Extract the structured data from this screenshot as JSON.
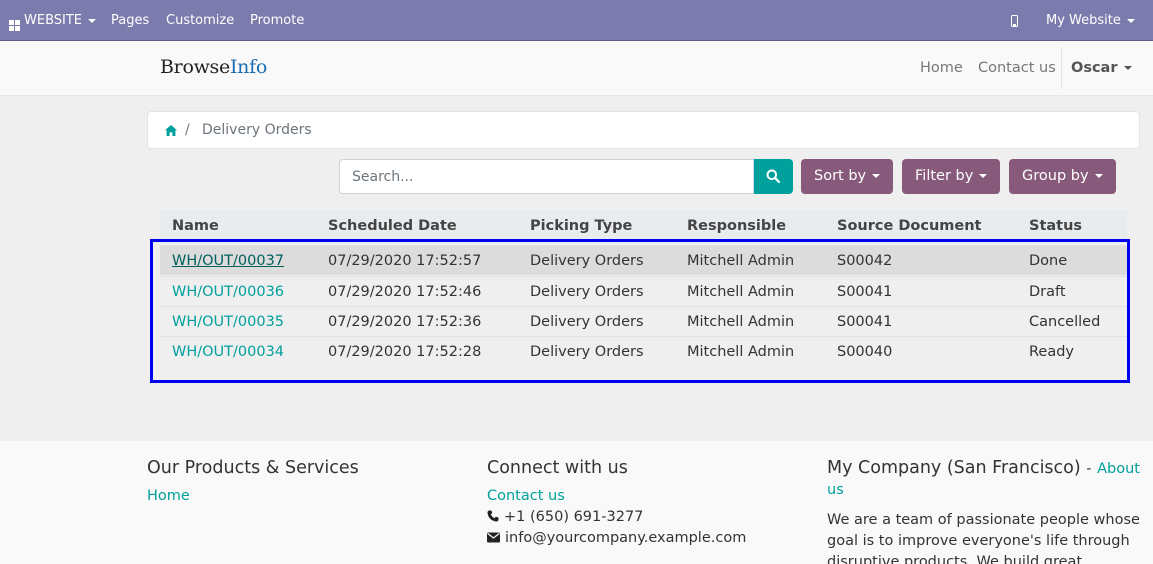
{
  "topbar": {
    "website_label": "WEBSITE",
    "pages_label": "Pages",
    "customize_label": "Customize",
    "promote_label": "Promote",
    "mobile_icon": "mobile-phone-icon",
    "site_selector_label": "My Website",
    "background_color": "#7c7bad"
  },
  "header": {
    "logo_part1": "Browse",
    "logo_part2": "Info",
    "nav": {
      "home": "Home",
      "contact": "Contact us",
      "user": "Oscar"
    }
  },
  "breadcrumb": {
    "home_icon": "home-icon",
    "separator": "/",
    "current": "Delivery Orders"
  },
  "search": {
    "placeholder": "Search...",
    "button_icon": "search-icon"
  },
  "toolbar": {
    "sort_label": "Sort by",
    "filter_label": "Filter by",
    "group_label": "Group by",
    "button_color": "#875a7b",
    "accent_color": "#00a09d"
  },
  "table": {
    "columns": [
      "Name",
      "Scheduled Date",
      "Picking Type",
      "Responsible",
      "Source Document",
      "Status"
    ],
    "rows": [
      {
        "name": "WH/OUT/00037",
        "date": "07/29/2020 17:52:57",
        "type": "Delivery Orders",
        "responsible": "Mitchell Admin",
        "source": "S00042",
        "status": "Done"
      },
      {
        "name": "WH/OUT/00036",
        "date": "07/29/2020 17:52:46",
        "type": "Delivery Orders",
        "responsible": "Mitchell Admin",
        "source": "S00041",
        "status": "Draft"
      },
      {
        "name": "WH/OUT/00035",
        "date": "07/29/2020 17:52:36",
        "type": "Delivery Orders",
        "responsible": "Mitchell Admin",
        "source": "S00041",
        "status": "Cancelled"
      },
      {
        "name": "WH/OUT/00034",
        "date": "07/29/2020 17:52:28",
        "type": "Delivery Orders",
        "responsible": "Mitchell Admin",
        "source": "S00040",
        "status": "Ready"
      }
    ]
  },
  "footer": {
    "products": {
      "title": "Our Products & Services",
      "home_link": "Home"
    },
    "connect": {
      "title": "Connect with us",
      "contact_link": "Contact us",
      "phone": "+1 (650) 691-3277",
      "email": "info@yourcompany.example.com"
    },
    "company": {
      "title": "My Company (San Francisco)",
      "separator": "-",
      "about_link_1": "About",
      "about_link_2": "us",
      "about_text": "We are a team of passionate people whose goal is to improve everyone's life through disruptive products. We build great"
    }
  }
}
